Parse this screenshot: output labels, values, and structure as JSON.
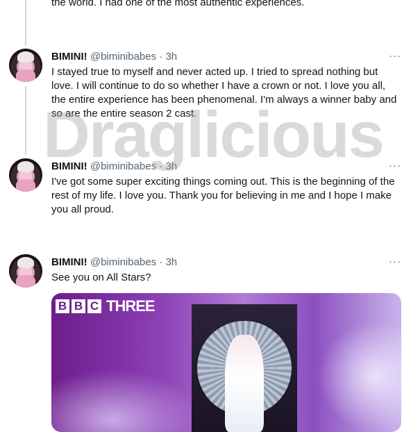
{
  "top_tweet": {
    "text": "the world. I had one of the most authentic experiences."
  },
  "tweets": [
    {
      "name": "BIMINI!",
      "handle": "@biminibabes",
      "sep": "·",
      "time": "3h",
      "text": "I stayed true to myself and never acted up. I tried to spread nothing but love. I will continue to do so whether I have a crown or not. I love you all, the entire experience has been phenomenal. I'm always a winner baby and so are the entire season 2 cast."
    },
    {
      "name": "BIMINI!",
      "handle": "@biminibabes",
      "sep": "·",
      "time": "3h",
      "text": "I've got some super exciting things coming out. This is the beginning of the rest of my life. I love you. Thank you for believing in me and I hope I make you all proud."
    },
    {
      "name": "BIMINI!",
      "handle": "@biminibabes",
      "sep": "·",
      "time": "3h",
      "text": "See you on All Stars?"
    }
  ],
  "more_label": "···",
  "media": {
    "brand_letters": [
      "B",
      "B",
      "C"
    ],
    "brand_word": "THREE"
  },
  "watermark": "Draglicious"
}
